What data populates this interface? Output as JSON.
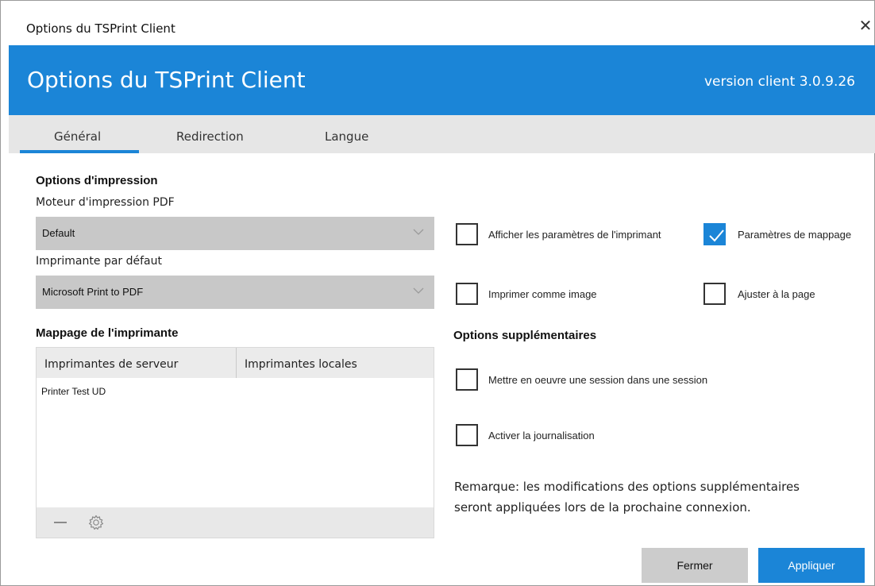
{
  "window": {
    "title": "Options du TSPrint Client",
    "close_glyph": "✕"
  },
  "banner": {
    "title": "Options du TSPrint Client",
    "version": "version client 3.0.9.26",
    "color": "#1b85d7"
  },
  "tabs": [
    {
      "label": "Général",
      "active": true
    },
    {
      "label": "Redirection",
      "active": false
    },
    {
      "label": "Langue",
      "active": false
    }
  ],
  "print_options": {
    "heading": "Options d'impression",
    "pdf_engine_label": "Moteur d'impression PDF",
    "pdf_engine_value": "Default",
    "default_printer_label": "Imprimante par défaut",
    "default_printer_value": "Microsoft Print to PDF"
  },
  "mapping": {
    "heading": "Mappage de l'imprimante",
    "columns": [
      "Imprimantes de serveur",
      "Imprimantes locales"
    ],
    "rows": [
      {
        "server": "Printer Test UD",
        "local": ""
      }
    ],
    "icons": [
      "minus-icon",
      "gear-icon"
    ]
  },
  "checkboxes": [
    {
      "id": "show-printer-settings",
      "label": "Afficher les paramètres de l'imprimant",
      "checked": false
    },
    {
      "id": "mapping-settings",
      "label": "Paramètres de mappage",
      "checked": true
    },
    {
      "id": "print-as-image",
      "label": "Imprimer comme image",
      "checked": false
    },
    {
      "id": "fit-to-page",
      "label": "Ajuster à la page",
      "checked": false
    }
  ],
  "extra_options": {
    "heading": "Options supplémentaires",
    "checkboxes": [
      {
        "id": "session-in-session",
        "label": "Mettre en oeuvre une session dans une session",
        "checked": false
      },
      {
        "id": "enable-logging",
        "label": "Activer la journalisation",
        "checked": false
      }
    ],
    "note": "Remarque: les modifications des options supplémentaires seront appliquées lors de la prochaine connexion."
  },
  "buttons": {
    "close": "Fermer",
    "apply": "Appliquer"
  }
}
